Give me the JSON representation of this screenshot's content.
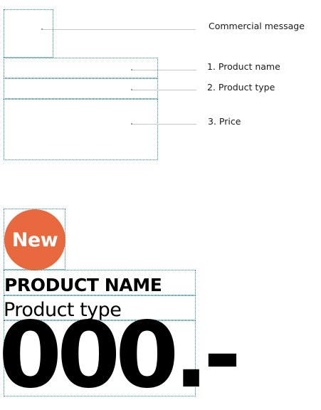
{
  "schematic": {
    "labels": {
      "commercial_message": "Commercial message",
      "product_name": "1. Product name",
      "product_type": "2. Product type",
      "price": "3. Price"
    }
  },
  "example": {
    "badge_text": "New",
    "badge_color": "#e9693f",
    "product_name": "PRODUCT NAME",
    "product_type": "Product type",
    "price": "000.-"
  },
  "colors": {
    "guide_border": "#1f8a9a",
    "callout_line": "#c7c7c7"
  }
}
